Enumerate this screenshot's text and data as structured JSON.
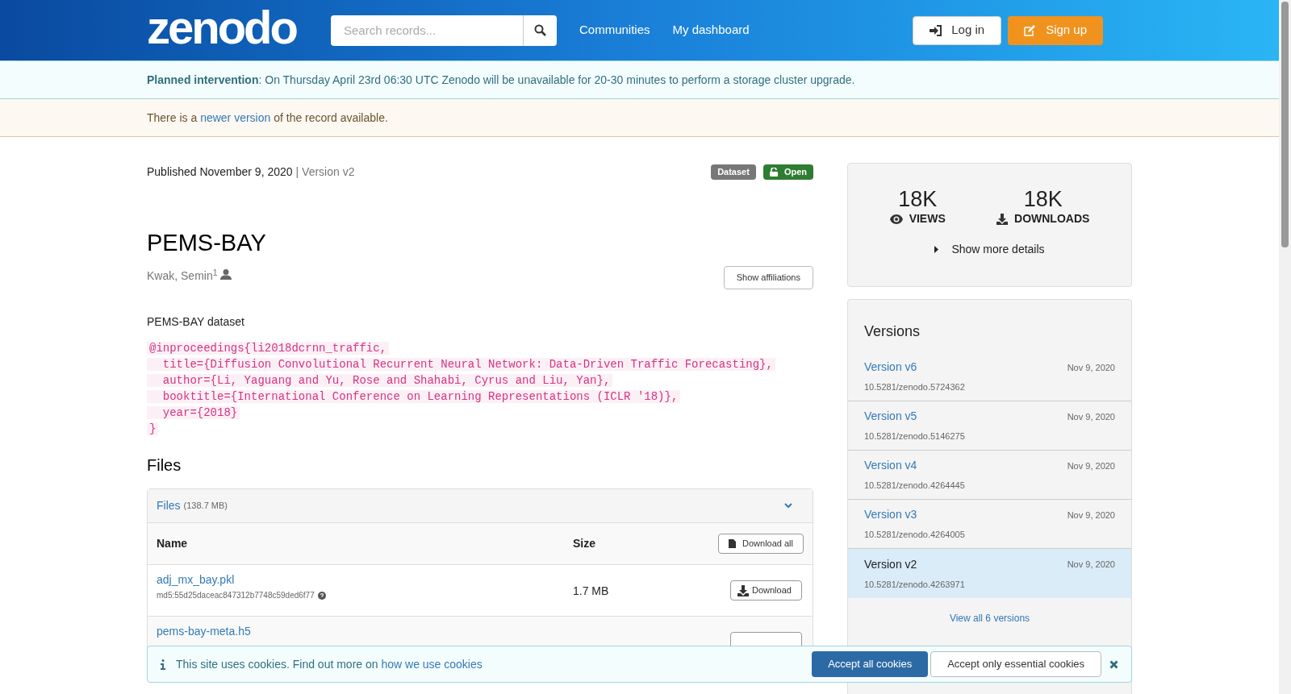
{
  "header": {
    "logo": "zenodo",
    "search": {
      "placeholder": "Search records..."
    },
    "nav": [
      "Communities",
      "My dashboard"
    ],
    "login": "Log in",
    "signup": "Sign up"
  },
  "banners": {
    "planned": {
      "bold": "Planned intervention",
      "text": ": On Thursday April 23rd 06:30 UTC Zenodo will be unavailable for 20-30 minutes to perform a storage cluster upgrade."
    },
    "newer": {
      "before": "There is a",
      "link": "newer version",
      "after": "of the record available."
    }
  },
  "record": {
    "published": "Published November 9, 2020",
    "version": "| Version v2",
    "badges": [
      {
        "label": "Dataset",
        "kind": "type"
      },
      {
        "label": "Open",
        "kind": "access"
      }
    ],
    "title": "PEMS-BAY",
    "author": {
      "name": "Kwak, Semin",
      "sup": "1"
    },
    "show_affiliations": "Show affiliations",
    "description": "PEMS-BAY dataset",
    "citation": [
      "@inproceedings{li2018dcrnn_traffic,",
      "  title={Diffusion Convolutional Recurrent Neural Network: Data-Driven Traffic Forecasting},",
      "  author={Li, Yaguang and Yu, Rose and Shahabi, Cyrus and Liu, Yan},",
      "  booktitle={International Conference on Learning Representations (ICLR '18)},",
      "  year={2018}",
      "}"
    ]
  },
  "files": {
    "heading": "Files",
    "panel_title": "Files",
    "panel_size": "(138.7 MB)",
    "columns": [
      "Name",
      "Size"
    ],
    "download_all": "Download all",
    "rows": [
      {
        "name": "adj_mx_bay.pkl",
        "md5": "md5:55d25daceac847312b7748c59ded6f77",
        "size": "1.7 MB",
        "button": "Download"
      },
      {
        "name": "pems-bay-meta.h5"
      }
    ]
  },
  "stats": {
    "items": [
      {
        "value": "18K",
        "label": "VIEWS",
        "kind": "views"
      },
      {
        "value": "18K",
        "label": "DOWNLOADS",
        "kind": "downloads"
      }
    ],
    "show_more": "Show more details"
  },
  "versions": {
    "title": "Versions",
    "items": [
      {
        "label": "Version v6",
        "date": "Nov 9, 2020",
        "doi": "10.5281/zenodo.5724362",
        "selected": false
      },
      {
        "label": "Version v5",
        "date": "Nov 9, 2020",
        "doi": "10.5281/zenodo.5146275",
        "selected": false
      },
      {
        "label": "Version v4",
        "date": "Nov 9, 2020",
        "doi": "10.5281/zenodo.4264445",
        "selected": false
      },
      {
        "label": "Version v3",
        "date": "Nov 9, 2020",
        "doi": "10.5281/zenodo.4264005",
        "selected": false
      },
      {
        "label": "Version v2",
        "date": "Nov 9, 2020",
        "doi": "10.5281/zenodo.4263971",
        "selected": true
      }
    ],
    "view_all": "View all 6 versions"
  },
  "cookie": {
    "text": "This site uses cookies. Find out more on",
    "link": "how we use cookies",
    "accept_all": "Accept all cookies",
    "accept_essential": "Accept only essential cookies"
  }
}
